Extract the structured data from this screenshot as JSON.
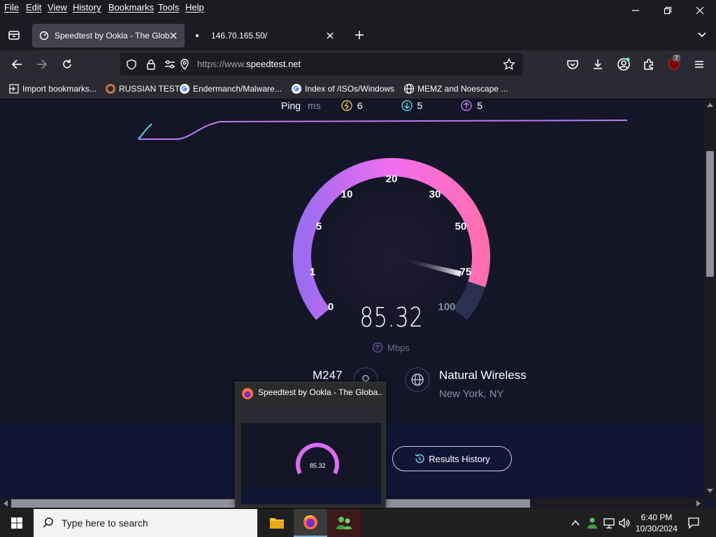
{
  "menubar": {
    "items": [
      "File",
      "Edit",
      "View",
      "History",
      "Bookmarks",
      "Tools",
      "Help"
    ]
  },
  "tabs": [
    {
      "label": "Speedtest by Ookla - The Globa",
      "active": true
    },
    {
      "label": "146.70.165.50/",
      "active": false
    }
  ],
  "navbar": {
    "url_prefix": "https://www.",
    "url_host": "speedtest.net",
    "extension_badge": "7"
  },
  "bookmarks": [
    {
      "label": "Import bookmarks...",
      "icon": "import-icon"
    },
    {
      "label": "RUSSIAN TEST",
      "icon": "ring-icon"
    },
    {
      "label": "Endermanch/Malware...",
      "icon": "google-icon"
    },
    {
      "label": "Index of /ISOs/Windows",
      "icon": "google-icon"
    },
    {
      "label": "MEMZ and Noescape ...",
      "icon": "globe-icon"
    }
  ],
  "speedtest": {
    "ping_label": "Ping",
    "ping_unit": "ms",
    "ping_idle": "6",
    "ping_download": "5",
    "ping_upload": "5",
    "gauge_labels": [
      "0",
      "1",
      "5",
      "10",
      "20",
      "30",
      "50",
      "75",
      "100"
    ],
    "speed_value": "85.32",
    "speed_unit": "Mbps",
    "server_name": "M247",
    "isp_name": "Natural Wireless",
    "isp_location": "New York, NY",
    "results_history": "Results History",
    "accent_start": "#9b6cf0",
    "accent_end": "#ff6fd8"
  },
  "thumbnail": {
    "title": "Speedtest by Ookla - The Globa...",
    "preview_value": "85.32"
  },
  "taskbar": {
    "search_placeholder": "Type here to search",
    "time": "6:40 PM",
    "date": "10/30/2024"
  }
}
